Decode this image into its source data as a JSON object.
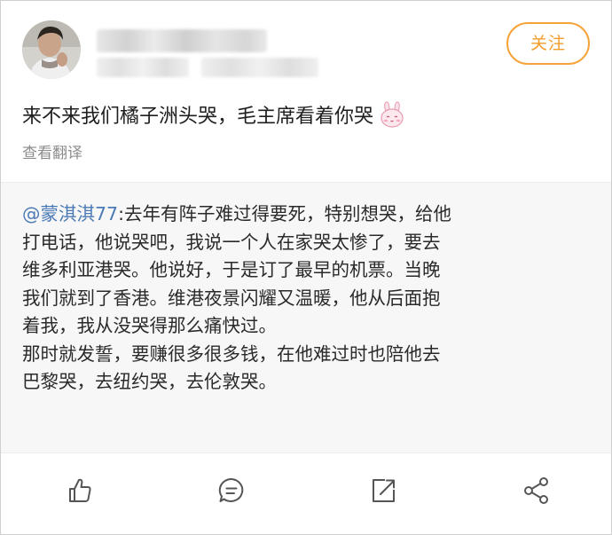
{
  "post": {
    "text": "来不来我们橘子洲头哭，毛主席看着你哭",
    "emoji": "bunny-emoji",
    "translate_label": "查看翻译"
  },
  "header": {
    "follow_label": "关注"
  },
  "retweet": {
    "mention": "@蒙淇淇77",
    "line1_rest": ":去年有阵子难过得要死，特别想哭，给他",
    "lines": [
      "打电话，他说哭吧，我说一个人在家哭太惨了，要去",
      "维多利亚港哭。他说好，于是订了最早的机票。当晚",
      "我们就到了香港。维港夜景闪耀又温暖，他从后面抱",
      "着我，我从没哭得那么痛快过。",
      "那时就发誓，要赚很多很多钱，在他难过时也陪他去",
      "巴黎哭，去纽约哭，去伦敦哭。"
    ]
  },
  "actions": {
    "icons": [
      "thumbs-up-icon",
      "comment-icon",
      "repost-icon",
      "share-icon"
    ]
  },
  "colors": {
    "accent": "#f39c2b",
    "link": "#4a7ab6",
    "muted": "#8c8c8c",
    "retweet_bg": "#f7f7f7"
  }
}
